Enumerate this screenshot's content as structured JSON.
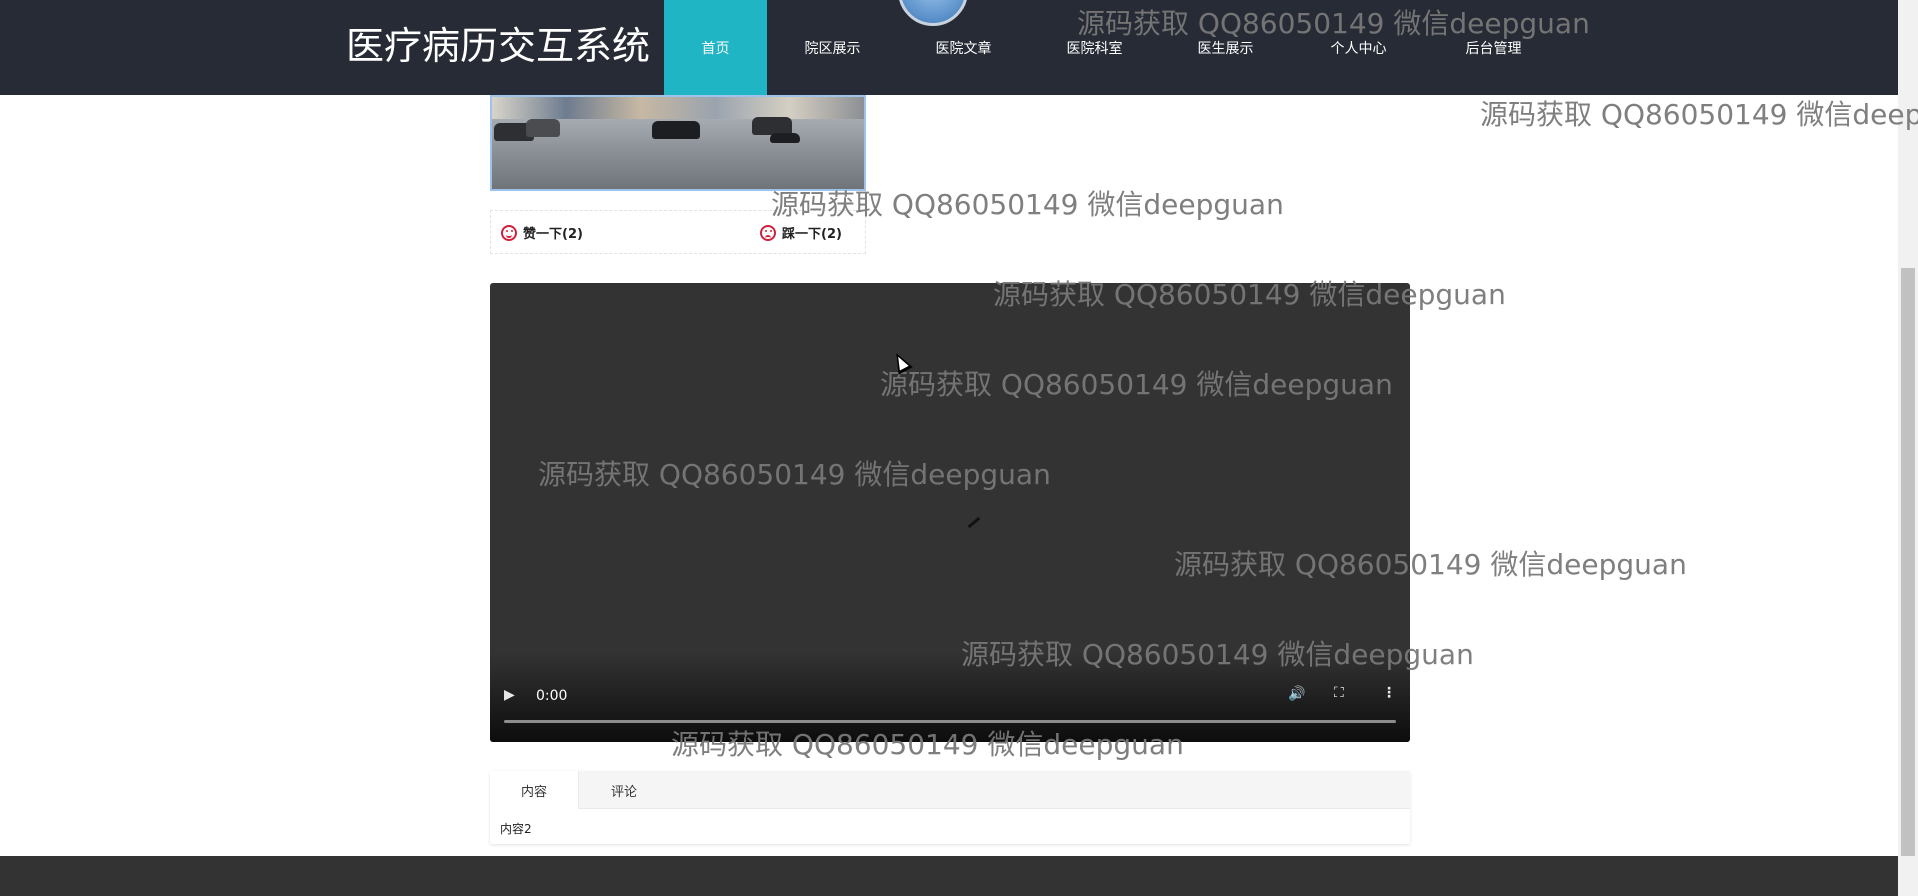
{
  "header": {
    "brand": "医疗病历交互系统",
    "nav": [
      {
        "label": "首页",
        "active": true
      },
      {
        "label": "院区展示",
        "active": false
      },
      {
        "label": "医院文章",
        "active": false
      },
      {
        "label": "医院科室",
        "active": false
      },
      {
        "label": "医生展示",
        "active": false
      },
      {
        "label": "个人中心",
        "active": false
      },
      {
        "label": "后台管理",
        "active": false
      }
    ],
    "colors": {
      "bar": "#262b35",
      "active": "#1fb5c4"
    }
  },
  "article": {
    "like_label": "赞一下(2)",
    "dislike_label": "踩一下(2)"
  },
  "video": {
    "time": "0:00",
    "progress": 0
  },
  "tabs": {
    "items": [
      {
        "label": "内容",
        "active": true
      },
      {
        "label": "评论",
        "active": false
      }
    ],
    "content": "内容2"
  },
  "watermark": {
    "text": "源码获取 QQ86050149 微信deepguan"
  }
}
